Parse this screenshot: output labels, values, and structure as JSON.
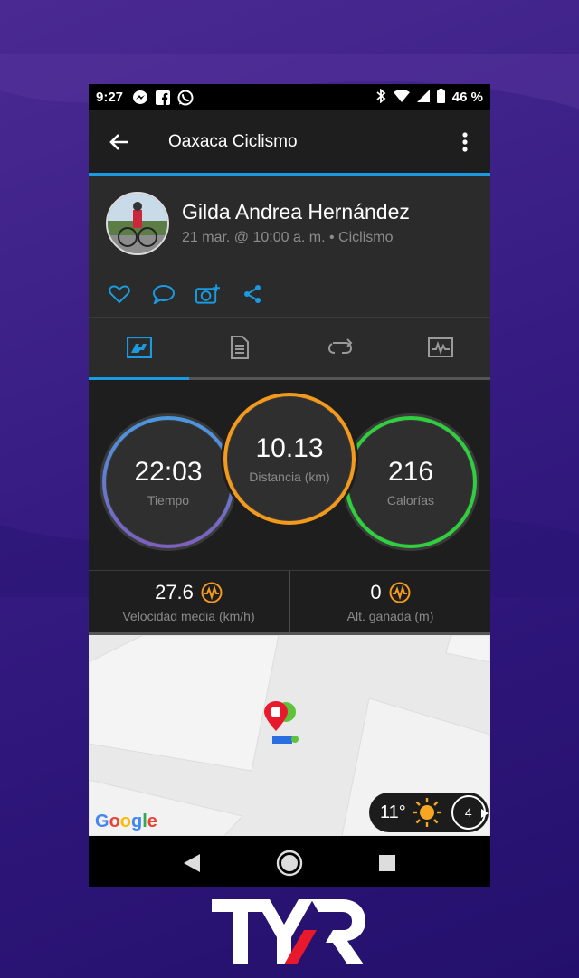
{
  "status_bar": {
    "time": "9:27",
    "battery": "46 %"
  },
  "app_bar": {
    "title": "Oaxaca Ciclismo"
  },
  "activity": {
    "user_name": "Gilda Andrea Hernández",
    "meta": "21 mar. @ 10:00 a. m. • Ciclismo"
  },
  "tabs": [
    "summary-tab",
    "details-tab",
    "laps-tab",
    "charts-tab"
  ],
  "stats": {
    "time": {
      "value": "22:03",
      "label": "Tiempo",
      "color": "#4a98e0"
    },
    "distance": {
      "value": "10.13",
      "label": "Distancia (km)",
      "color": "#f39a1c"
    },
    "calories": {
      "value": "216",
      "label": "Calorías",
      "color": "#2fcf3e"
    }
  },
  "sub_stats": {
    "avg_speed": {
      "value": "27.6",
      "label": "Velocidad media (km/h)"
    },
    "elevation": {
      "value": "0",
      "label": "Alt. ganada (m)"
    }
  },
  "map": {
    "provider": "Google",
    "temperature": "11°",
    "wind": "4"
  },
  "colors": {
    "accent": "#1a9ae0",
    "orange": "#f39a1c"
  }
}
